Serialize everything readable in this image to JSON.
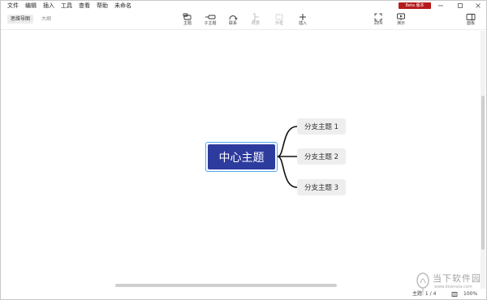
{
  "menu": {
    "items": [
      "文件",
      "编辑",
      "插入",
      "工具",
      "查看",
      "帮助",
      "未命名"
    ]
  },
  "badge": {
    "label": "Beta 版本",
    "color": "#b51b1b"
  },
  "view_tabs": [
    {
      "label": "思维导图",
      "active": true
    },
    {
      "label": "大纲",
      "active": false
    }
  ],
  "toolbar": {
    "topic": "主题",
    "subtopic": "子主题",
    "relationship": "联系",
    "summary": "概要",
    "boundary": "外框",
    "insert": "插入",
    "zen": "ZEN",
    "present": "演示",
    "panel": "面板"
  },
  "map": {
    "central": "中心主题",
    "central_color": "#2e3b9e",
    "branches": [
      "分支主题 1",
      "分支主题 2",
      "分支主题 3"
    ]
  },
  "status": {
    "topic_count": "主题: 1 / 4",
    "zoom": "100%"
  },
  "watermark": {
    "title": "当下软件园",
    "url": "www.downxia.com"
  }
}
